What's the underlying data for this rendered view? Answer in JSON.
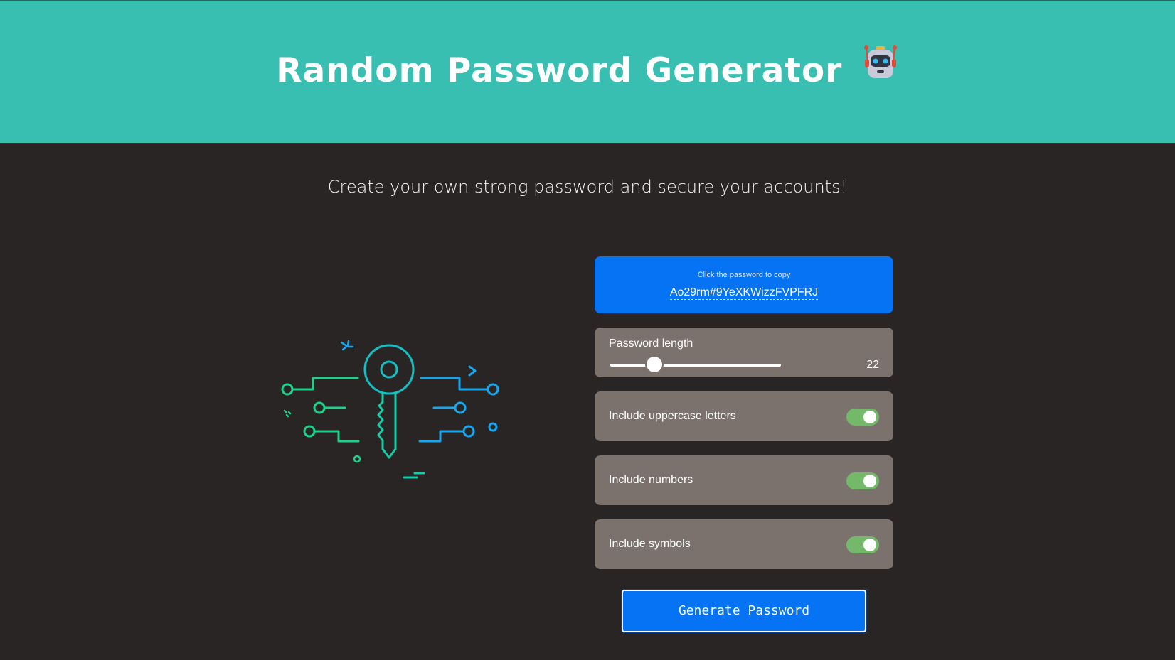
{
  "header": {
    "title": "Random Password Generator"
  },
  "tagline": "Create your own strong password and secure your accounts!",
  "password": {
    "hint": "Click the password to copy",
    "value": "Ao29rm#9YeXKWizzFVPFRJ"
  },
  "length": {
    "label": "Password length",
    "value": "22",
    "fraction": 0.26
  },
  "options": [
    {
      "label": "Include uppercase letters",
      "enabled": true
    },
    {
      "label": "Include numbers",
      "enabled": true
    },
    {
      "label": "Include symbols",
      "enabled": true
    }
  ],
  "generate_label": "Generate Password",
  "colors": {
    "header_bg": "#39bfb2",
    "page_bg": "#282524",
    "accent_blue": "#0673f5",
    "option_bg": "#7b726d",
    "toggle_on": "#74b86a",
    "illustration_green": "#18d48a",
    "illustration_blue": "#13a8f0"
  },
  "icons": {
    "header": "robot-icon",
    "illustration": "key-circuit-illustration"
  }
}
